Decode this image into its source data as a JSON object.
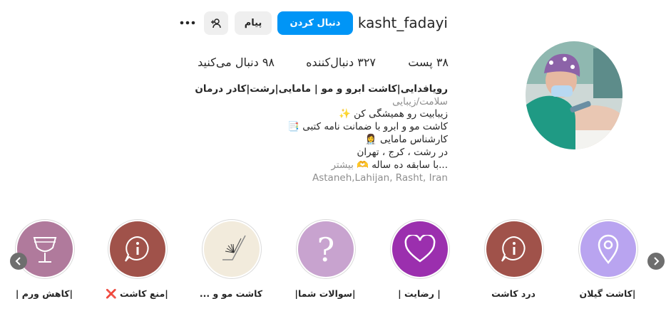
{
  "profile": {
    "username": "kasht_fadayi",
    "follow_label": "دنبال کردن",
    "message_label": "پیام",
    "add_user_icon": "add-user-icon",
    "more_icon": "more-icon"
  },
  "stats": {
    "posts": "۳۸ پست",
    "followers": "۳۲۷ دنبال‌کننده",
    "following": "۹۸ دنبال می‌کنید"
  },
  "bio": {
    "name": "رویافدایی|کاشت ابرو و مو | مامایی|رشت|کادر درمان",
    "category": "سلامت/زیبایی",
    "line1": "زیبابیت رو همیشگی کن ✨",
    "line2": "کاشت مو و ابرو با ضمانت نامه کتبی 📑",
    "line3": "کارشناس مامایی 👩‍⚕️",
    "line4": "در رشت ، کرج ، تهران",
    "line5": "...با سابقه ده ساله 🫶",
    "more_label": "بیشتر",
    "location": "Astaneh,Lahijan, Rasht, Iran"
  },
  "highlights": [
    {
      "label": "|کاشت گیلان",
      "color": "#b9a4f0",
      "icon": "location-pin-icon"
    },
    {
      "label": "درد کاشت",
      "color": "#a0524a",
      "icon": "info-bubble-icon"
    },
    {
      "label": "| رضایت |",
      "color": "#9b2fae",
      "icon": "heart-icon"
    },
    {
      "label": "|سوالات شما|",
      "color": "#c8a3cf",
      "icon": "question-icon"
    },
    {
      "label": "کاشت مو و ...",
      "color": "#f2ebdc",
      "icon": "brush-icon"
    },
    {
      "label": "|منع کاشت ❌",
      "color": "#a0524a",
      "icon": "info-bubble-icon"
    },
    {
      "label": "|کاهش ورم |",
      "color": "#b07a9c",
      "icon": "glass-icon"
    }
  ],
  "nav": {
    "prev_icon": "chevron-left-icon",
    "next_icon": "chevron-right-icon"
  }
}
